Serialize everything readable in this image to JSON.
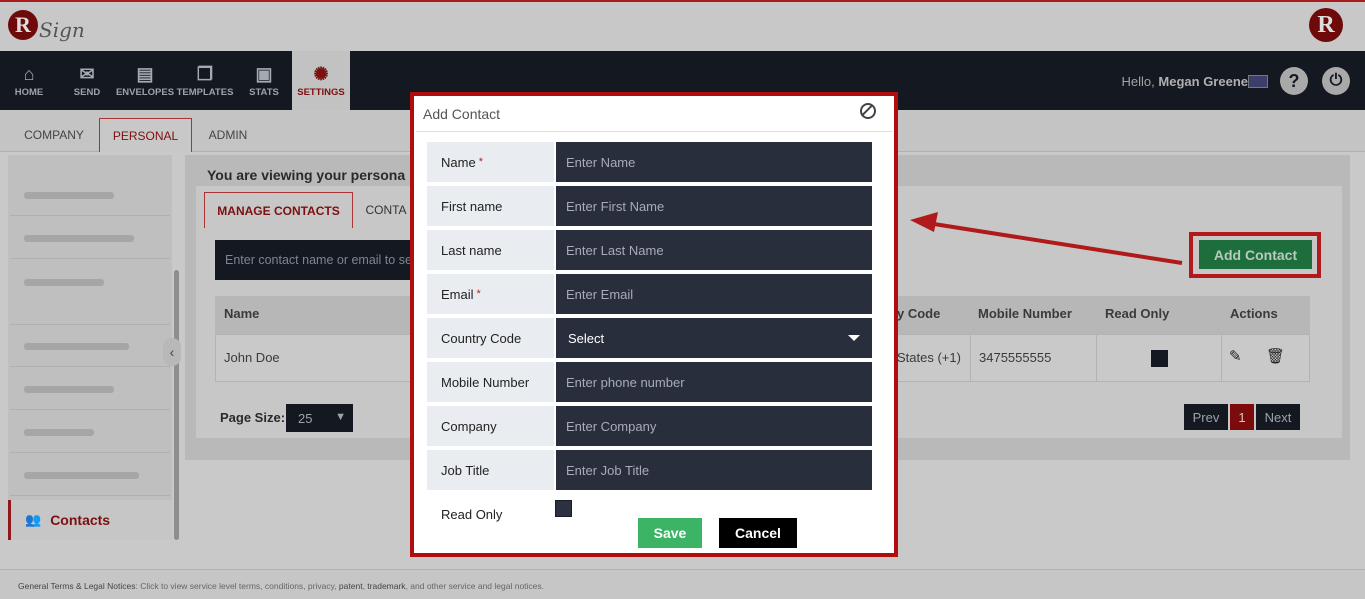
{
  "header": {
    "logo_r": "R",
    "logo_sign": "Sign",
    "brand_r": "R"
  },
  "nav": {
    "items": [
      {
        "label": "HOME",
        "icon": "home-icon",
        "glyph": "⌂"
      },
      {
        "label": "SEND",
        "icon": "envelope-icon",
        "glyph": "✉"
      },
      {
        "label": "ENVELOPES",
        "icon": "envelopes-icon",
        "glyph": "▤"
      },
      {
        "label": "TEMPLATES",
        "icon": "templates-icon",
        "glyph": "❐"
      },
      {
        "label": "STATS",
        "icon": "briefcase-icon",
        "glyph": "▣"
      },
      {
        "label": "SETTINGS",
        "icon": "gear-icon",
        "glyph": "✺"
      }
    ],
    "greeting_prefix": "Hello,",
    "user_name": "Megan Greene",
    "help": "?",
    "power": "⏻"
  },
  "subtabs": [
    "COMPANY",
    "PERSONAL",
    "ADMIN"
  ],
  "sidebar": {
    "active_label": "Contacts",
    "active_icon": "contacts-icon"
  },
  "main": {
    "viewing_text": "You are viewing your persona",
    "tabs": [
      "MANAGE CONTACTS",
      "CONTA"
    ],
    "search_placeholder": "Enter contact name or email to se",
    "add_contact_label": "Add Contact",
    "table": {
      "headers": [
        "Name",
        "y Code",
        "Mobile Number",
        "Read Only",
        "Actions"
      ],
      "row": {
        "name": "John Doe",
        "country": "States (+1)",
        "mobile": "3475555555"
      }
    },
    "page_size_label": "Page Size:",
    "page_size_value": "25",
    "pager": {
      "prev": "Prev",
      "current": "1",
      "next": "Next"
    }
  },
  "modal": {
    "title": "Add Contact",
    "fields": [
      {
        "label": "Name",
        "required": true,
        "placeholder": "Enter Name"
      },
      {
        "label": "First name",
        "required": false,
        "placeholder": "Enter First Name"
      },
      {
        "label": "Last name",
        "required": false,
        "placeholder": "Enter Last Name"
      },
      {
        "label": "Email",
        "required": true,
        "placeholder": "Enter Email"
      },
      {
        "label": "Country Code",
        "required": false,
        "select_value": "Select"
      },
      {
        "label": "Mobile Number",
        "required": false,
        "placeholder": "Enter phone number"
      },
      {
        "label": "Company",
        "required": false,
        "placeholder": "Enter Company"
      },
      {
        "label": "Job Title",
        "required": false,
        "placeholder": "Enter Job Title"
      }
    ],
    "read_only_label": "Read Only",
    "save_label": "Save",
    "cancel_label": "Cancel",
    "required_mark": "*"
  },
  "footer": {
    "link_text": "General Terms & Legal Notices",
    "text_a": ": Click to view service level terms, conditions, privacy, ",
    "patent": "patent",
    "sep": ", ",
    "trademark": "trademark",
    "text_b": ", and other service and legal notices."
  },
  "colors": {
    "brand_red": "#b10d0d",
    "nav_dark": "#141820",
    "field_dark": "#282e3c",
    "save_green": "#3bb465"
  }
}
